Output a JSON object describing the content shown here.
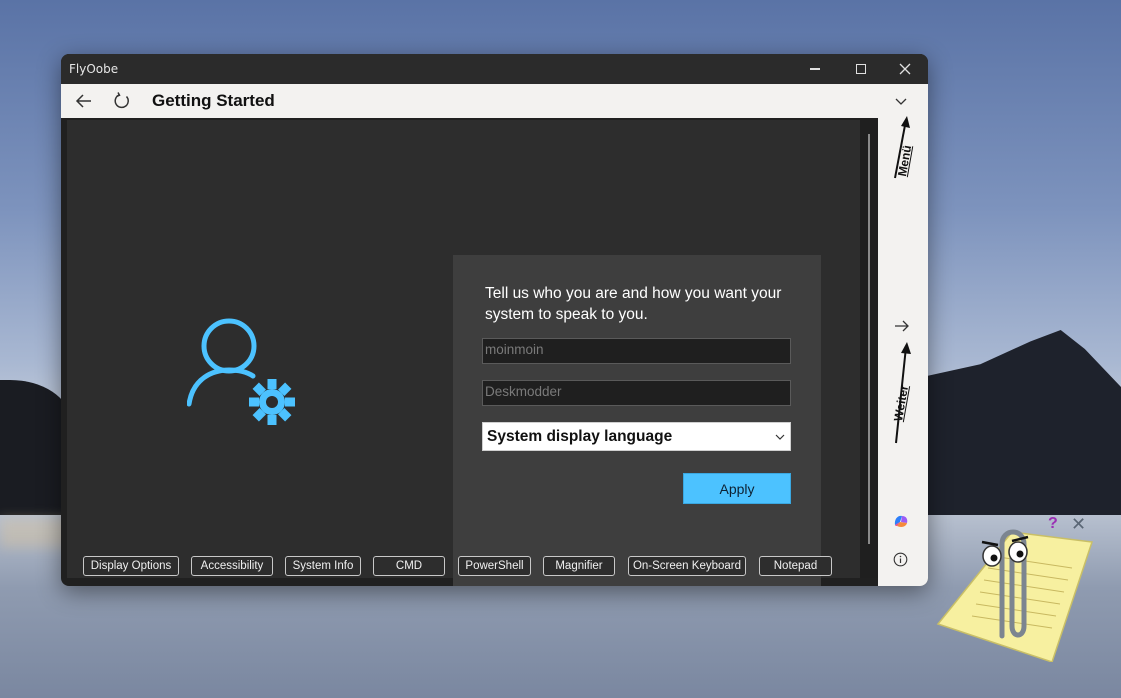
{
  "window": {
    "title": "FlyOobe",
    "controls": {
      "minimize": "minimize",
      "maximize": "maximize",
      "close": "close"
    }
  },
  "navbar": {
    "title": "Getting Started",
    "icons": [
      "back-arrow-icon",
      "refresh-icon",
      "chevron-down-icon"
    ]
  },
  "card": {
    "heading": "Tell us who you are and how you want your system to speak to you.",
    "username_placeholder": "moinmoin",
    "organization_placeholder": "Deskmodder",
    "language_select": "System display language",
    "apply_label": "Apply"
  },
  "toolbar": {
    "buttons": [
      "Display Options",
      "Accessibility",
      "System Info",
      "CMD",
      "PowerShell",
      "Magnifier",
      "On-Screen Keyboard",
      "Notepad"
    ]
  },
  "side_panel": {
    "menu_label": "Menü",
    "next_label": "Weiter",
    "icons": [
      "arrow-right-icon",
      "copilot-icon",
      "info-icon"
    ]
  },
  "clippy": {
    "help": "?",
    "close": "✕"
  },
  "colors": {
    "accent": "#4cc2ff",
    "content_bg": "#2d2d2d",
    "card_bg": "#3e3e3e",
    "bar_bg": "#f3f2f0"
  }
}
